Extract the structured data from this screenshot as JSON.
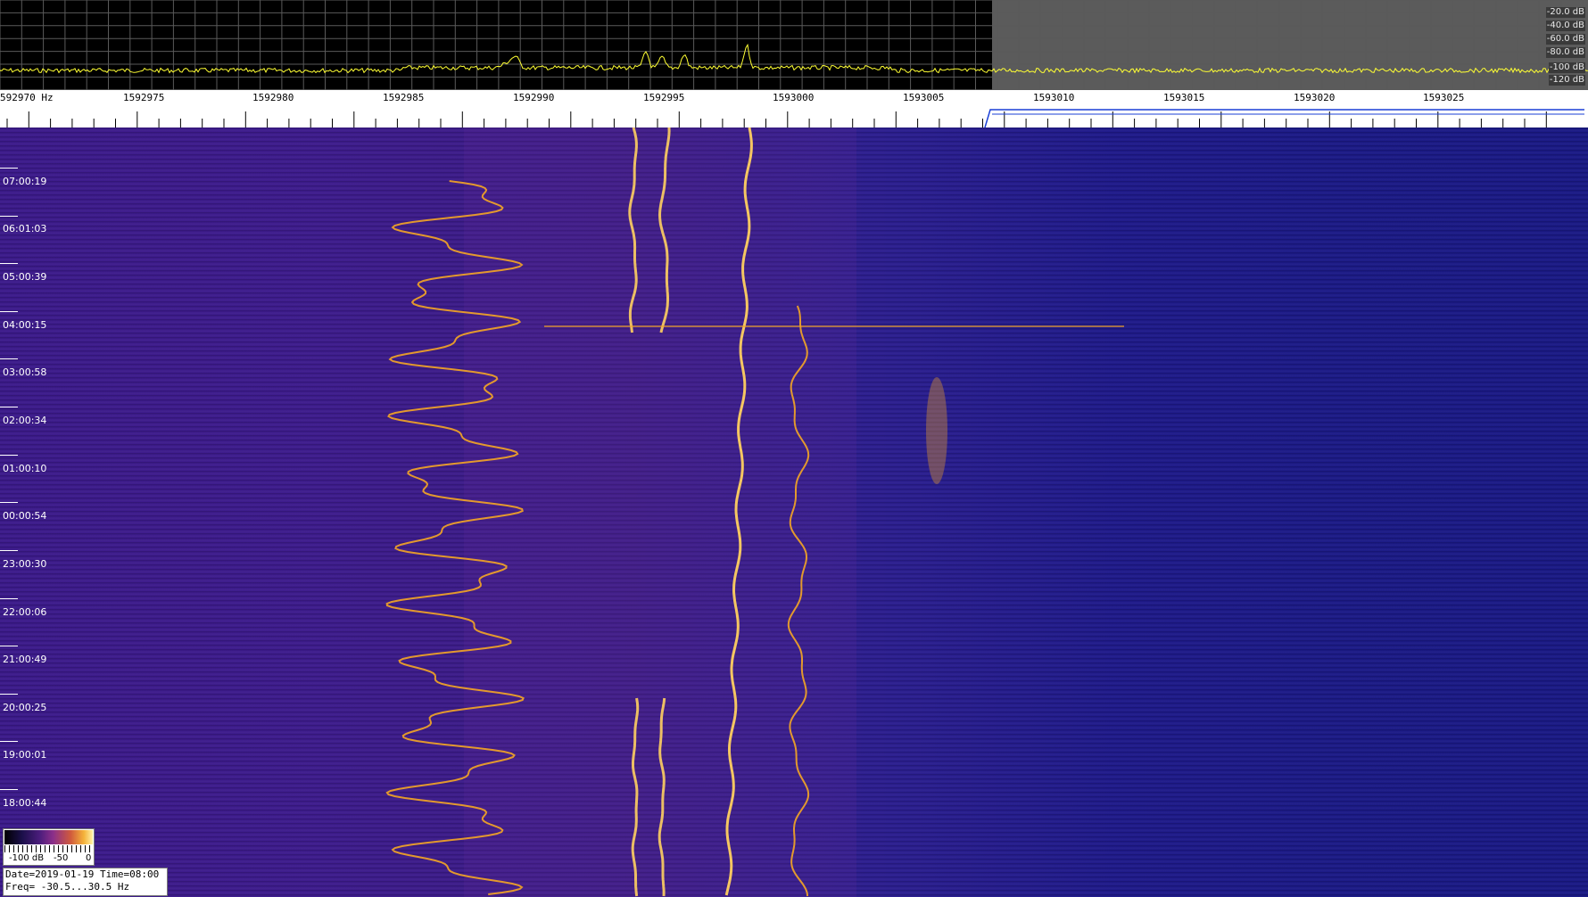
{
  "spectrum": {
    "db_labels": [
      "-20.0 dB",
      "-40.0 dB",
      "-60.0 dB",
      "-80.0 dB",
      "-100 dB",
      "-120 dB"
    ],
    "colors": {
      "trace": "#ffff33",
      "grid": "#5a5a5a",
      "background": "#000000",
      "shaded_region": "#5b5b5b"
    }
  },
  "ruler": {
    "freq_labels": [
      "592970 Hz",
      "1592975",
      "1592980",
      "1592985",
      "1592990",
      "1592995",
      "1593000",
      "1593005",
      "1593010",
      "1593015",
      "1593020",
      "1593025"
    ]
  },
  "waterfall": {
    "time_labels": [
      "07:00:19",
      "06:01:03",
      "05:00:39",
      "04:00:15",
      "03:00:58",
      "02:00:34",
      "01:00:10",
      "00:00:54",
      "23:00:30",
      "22:00:06",
      "21:00:49",
      "20:00:25",
      "19:00:01",
      "18:00:44"
    ],
    "colors": {
      "signal": "#f5a623",
      "signal_peak": "#ffd060",
      "background": "#3a1c86"
    }
  },
  "colorscale": {
    "labels": [
      "-100 dB",
      "-50",
      "0"
    ]
  },
  "info": {
    "line1": "Date=2019-01-19 Time=08:00",
    "line2": "Freq= -30.5...30.5 Hz"
  }
}
